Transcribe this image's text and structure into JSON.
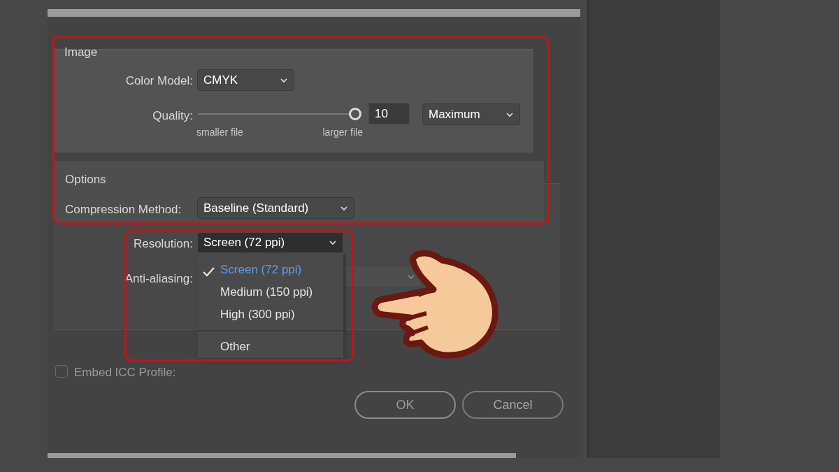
{
  "image_group": {
    "title": "Image",
    "color_model": {
      "label": "Color Model:",
      "value": "CMYK"
    },
    "quality": {
      "label": "Quality:",
      "level": 1,
      "value": "10",
      "preset": "Maximum",
      "min_label": "smaller file",
      "max_label": "larger file"
    }
  },
  "options_group": {
    "title": "Options",
    "compression": {
      "label": "Compression Method:",
      "value": "Baseline (Standard)"
    },
    "resolution": {
      "label": "Resolution:",
      "value": "Screen (72 ppi)",
      "expanded": true,
      "options": [
        {
          "label": "Screen (72 ppi)",
          "selected": true,
          "separator_before": false
        },
        {
          "label": "Medium (150 ppi)",
          "selected": false,
          "separator_before": false
        },
        {
          "label": "High (300 ppi)",
          "selected": false,
          "separator_before": false
        },
        {
          "label": "Other",
          "selected": false,
          "separator_before": true
        }
      ]
    },
    "anti_aliasing": {
      "label": "Anti-aliasing:"
    }
  },
  "embed_icc": {
    "label": "Embed ICC Profile:",
    "checked": false
  },
  "buttons": [
    {
      "label": "OK",
      "kind": "default"
    },
    {
      "label": "Cancel",
      "kind": "normal"
    }
  ]
}
